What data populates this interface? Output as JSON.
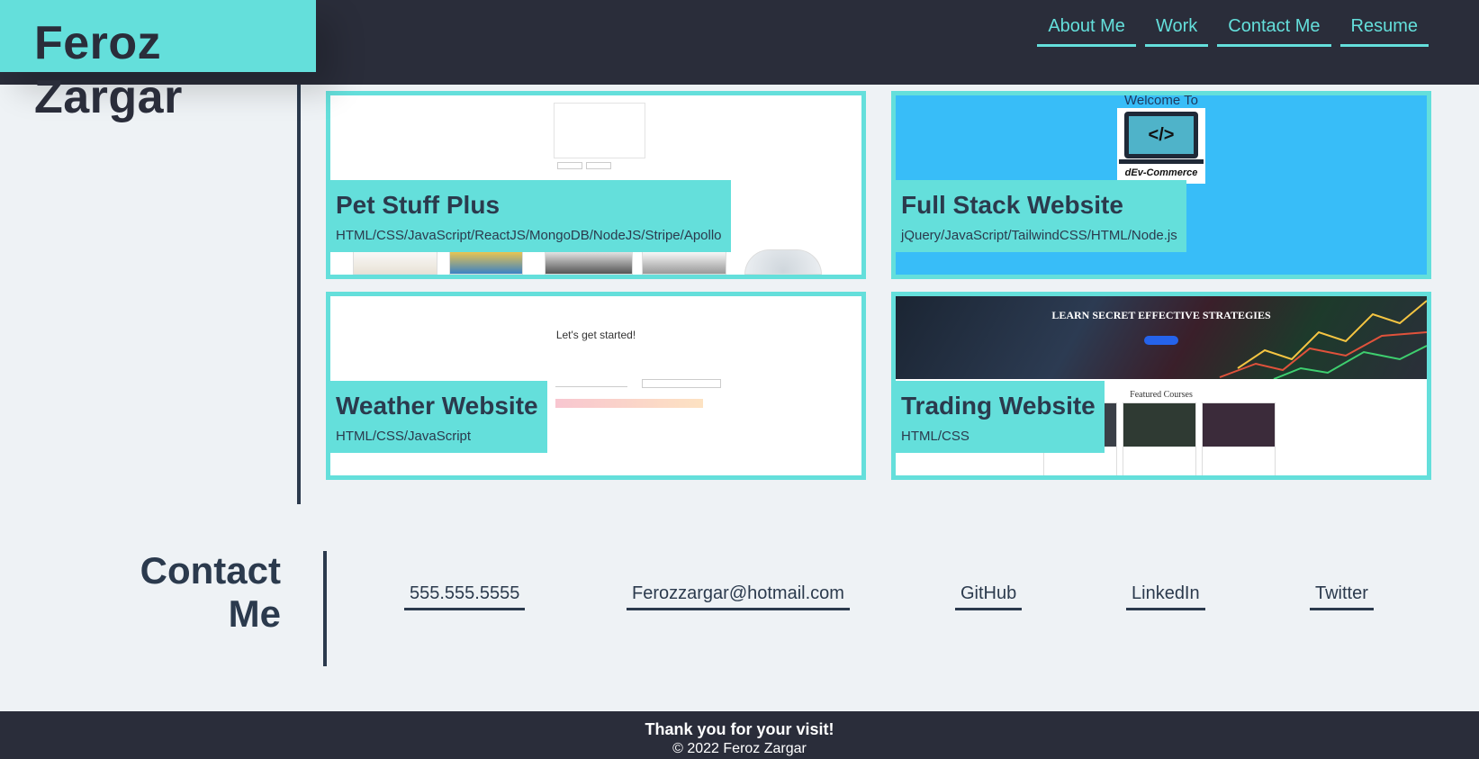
{
  "brand": {
    "name": "Feroz Zargar"
  },
  "nav": {
    "items": [
      {
        "label": "About Me"
      },
      {
        "label": "Work"
      },
      {
        "label": "Contact Me"
      },
      {
        "label": "Resume"
      }
    ]
  },
  "work": {
    "projects": [
      {
        "title": "Pet Stuff Plus",
        "tech": "HTML/CSS/JavaScript/ReactJS/MongoDB/NodeJS/Stripe/Apollo"
      },
      {
        "title": "Full Stack Website",
        "tech": "jQuery/JavaScript/TailwindCSS/HTML/Node.js",
        "preview": {
          "welcome": "Welcome To",
          "logo": "dEv-Commerce"
        }
      },
      {
        "title": "Weather Website",
        "tech": "HTML/CSS/JavaScript",
        "preview": {
          "heading": "Let's get started!"
        }
      },
      {
        "title": "Trading Website",
        "tech": "HTML/CSS",
        "preview": {
          "banner": "LEARN SECRET EFFECTIVE STRATEGIES",
          "courses": "Featured Courses"
        }
      }
    ]
  },
  "contact": {
    "title_line1": "Contact",
    "title_line2": "Me",
    "links": [
      {
        "label": "555.555.5555"
      },
      {
        "label": "Ferozzargar@hotmail.com"
      },
      {
        "label": "GitHub"
      },
      {
        "label": "LinkedIn"
      },
      {
        "label": "Twitter"
      }
    ]
  },
  "footer": {
    "thanks": "Thank you for your visit!",
    "copyright": "© 2022 Feroz Zargar"
  },
  "colors": {
    "accent": "#64dfdb",
    "dark": "#2a2d3a",
    "text": "#2b3a4d",
    "background": "#eef2f5",
    "card_blue": "#38bdf8"
  }
}
